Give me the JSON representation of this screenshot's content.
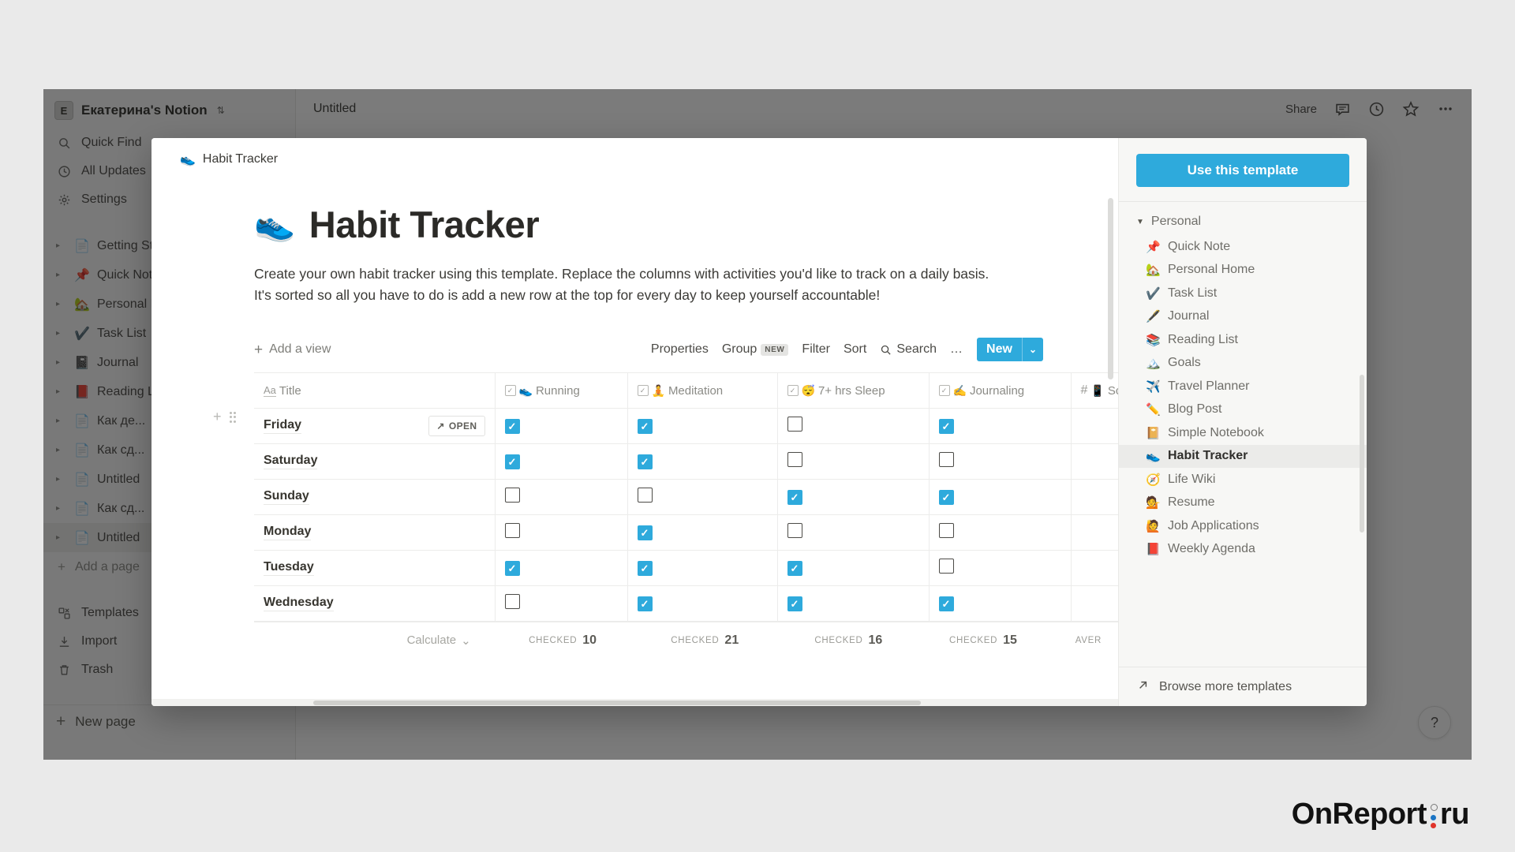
{
  "app": {
    "workspace_name": "Екатерина's Notion",
    "workspace_initial": "E",
    "workspace_caret": "⇅",
    "doc_tab_title": "Untitled",
    "help_label": "?"
  },
  "topbar": {
    "share_label": "Share",
    "comment_icon": "comment-icon",
    "updates_icon": "clock-icon",
    "favorite_icon": "star-icon",
    "more_icon": "more-horizontal-icon"
  },
  "sidebar": {
    "nav": [
      {
        "icon": "search-icon",
        "label": "Quick Find"
      },
      {
        "icon": "clock-icon",
        "label": "All Updates"
      },
      {
        "icon": "gear-icon",
        "label": "Settings"
      }
    ],
    "pages": [
      {
        "emoji": "📄",
        "label": "Getting Started",
        "selected": false
      },
      {
        "emoji": "📌",
        "label": "Quick Note",
        "selected": false
      },
      {
        "emoji": "🏡",
        "label": "Personal Home",
        "selected": false
      },
      {
        "emoji": "✔️",
        "label": "Task List",
        "selected": false
      },
      {
        "emoji": "📓",
        "label": "Journal",
        "selected": false
      },
      {
        "emoji": "📕",
        "label": "Reading List",
        "selected": false
      },
      {
        "emoji": "📄",
        "label": "Как де...",
        "selected": false
      },
      {
        "emoji": "📄",
        "label": "Как сд...",
        "selected": false
      },
      {
        "emoji": "📄",
        "label": "Untitled",
        "selected": false
      },
      {
        "emoji": "📄",
        "label": "Как сд...",
        "selected": false
      },
      {
        "emoji": "📄",
        "label": "Untitled",
        "selected": true
      }
    ],
    "add_page_label": "Add a page",
    "bottom": [
      {
        "icon": "templates-icon",
        "label": "Templates"
      },
      {
        "icon": "import-icon",
        "label": "Import"
      },
      {
        "icon": "trash-icon",
        "label": "Trash"
      }
    ],
    "new_page_label": "New page"
  },
  "modal": {
    "breadcrumb_emoji": "👟",
    "breadcrumb_label": "Habit Tracker",
    "title_emoji": "👟",
    "title": "Habit Tracker",
    "description": "Create your own habit tracker using this template. Replace the columns with activities you'd like to track on a daily basis. It's sorted so all you have to do is add a new row at the top for every day to keep yourself accountable!",
    "db_toolbar": {
      "add_view": "Add a view",
      "properties": "Properties",
      "group": "Group",
      "group_badge": "NEW",
      "filter": "Filter",
      "sort": "Sort",
      "search": "Search",
      "more": "…",
      "new_button": "New",
      "new_chevron": "⌄"
    }
  },
  "template_panel": {
    "use_template_label": "Use this template",
    "group_label": "Personal",
    "items": [
      {
        "emoji": "📌",
        "label": "Quick Note",
        "active": false
      },
      {
        "emoji": "🏡",
        "label": "Personal Home",
        "active": false
      },
      {
        "emoji": "✔️",
        "label": "Task List",
        "active": false
      },
      {
        "emoji": "🖋️",
        "label": "Journal",
        "active": false
      },
      {
        "emoji": "📚",
        "label": "Reading List",
        "active": false
      },
      {
        "emoji": "🏔️",
        "label": "Goals",
        "active": false
      },
      {
        "emoji": "✈️",
        "label": "Travel Planner",
        "active": false
      },
      {
        "emoji": "✏️",
        "label": "Blog Post",
        "active": false
      },
      {
        "emoji": "📔",
        "label": "Simple Notebook",
        "active": false
      },
      {
        "emoji": "👟",
        "label": "Habit Tracker",
        "active": true
      },
      {
        "emoji": "🧭",
        "label": "Life Wiki",
        "active": false
      },
      {
        "emoji": "💁",
        "label": "Resume",
        "active": false
      },
      {
        "emoji": "🙋",
        "label": "Job Applications",
        "active": false
      },
      {
        "emoji": "📕",
        "label": "Weekly Agenda",
        "active": false
      }
    ],
    "browse_more_label": "Browse more templates",
    "browse_more_icon": "arrow-up-right-icon"
  },
  "table": {
    "columns": [
      {
        "type": "title",
        "icon": "Aa",
        "emoji": "",
        "label": "Title"
      },
      {
        "type": "checkbox",
        "icon": "checkbox-icon",
        "emoji": "👟",
        "label": "Running"
      },
      {
        "type": "checkbox",
        "icon": "checkbox-icon",
        "emoji": "🧘",
        "label": "Meditation"
      },
      {
        "type": "checkbox",
        "icon": "checkbox-icon",
        "emoji": "😴",
        "label": "7+ hrs Sleep"
      },
      {
        "type": "checkbox",
        "icon": "checkbox-icon",
        "emoji": "✍️",
        "label": "Journaling"
      },
      {
        "type": "number",
        "icon": "#",
        "emoji": "📱",
        "label": "Screen"
      }
    ],
    "rows": [
      {
        "title": "Friday",
        "open_label": "OPEN",
        "checks": [
          true,
          true,
          false,
          true
        ]
      },
      {
        "title": "Saturday",
        "open_label": "",
        "checks": [
          true,
          true,
          false,
          false
        ]
      },
      {
        "title": "Sunday",
        "open_label": "",
        "checks": [
          false,
          false,
          true,
          true
        ]
      },
      {
        "title": "Monday",
        "open_label": "",
        "checks": [
          false,
          true,
          false,
          false
        ]
      },
      {
        "title": "Tuesday",
        "open_label": "",
        "checks": [
          true,
          true,
          true,
          false
        ]
      },
      {
        "title": "Wednesday",
        "open_label": "",
        "checks": [
          false,
          true,
          true,
          true
        ]
      }
    ],
    "calculate_label": "Calculate",
    "calculate_chevron": "⌄",
    "footer": [
      {
        "label": "CHECKED",
        "value": "10"
      },
      {
        "label": "CHECKED",
        "value": "21"
      },
      {
        "label": "CHECKED",
        "value": "16"
      },
      {
        "label": "CHECKED",
        "value": "15"
      },
      {
        "label": "AVER",
        "value": ""
      }
    ]
  },
  "watermark": {
    "part1": "OnReport",
    "part2": "ru"
  },
  "colors": {
    "accent": "#2eaadc",
    "sidebar_bg": "#fbfbfa",
    "panel_bg": "#f7f7f5",
    "text": "#37352f",
    "muted": "#8b8b86",
    "wm_blue": "#1a74c4",
    "wm_red": "#e0342b"
  }
}
